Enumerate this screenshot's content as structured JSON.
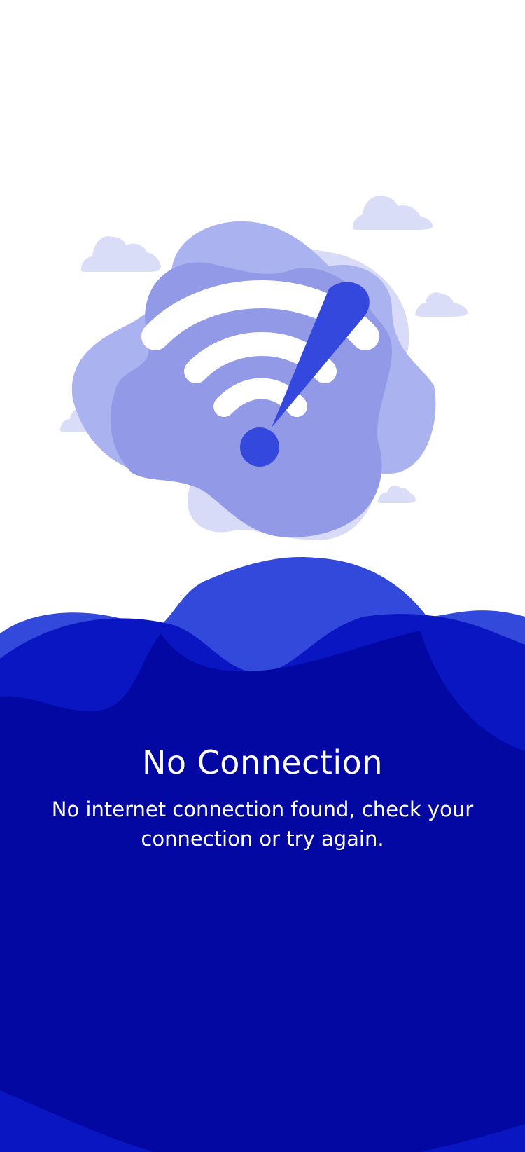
{
  "screen": {
    "title": "No Connection",
    "message": "No internet connection found, check your connection or try again."
  },
  "illustration": {
    "icon": "wifi-icon",
    "alert": "exclamation-icon",
    "decorations": [
      "cloud-icon",
      "blob-shape",
      "wave-shape"
    ]
  },
  "colors": {
    "background": "#ffffff",
    "wave_dark": "#0408A3",
    "wave_mid": "#0A16C2",
    "wave_light": "#3349DC",
    "blob_light": "#D8DBF8",
    "blob_mid": "#AAB3EF",
    "blob_dark": "#929AE8",
    "accent": "#3548DE",
    "cloud": "#DADDF8"
  }
}
